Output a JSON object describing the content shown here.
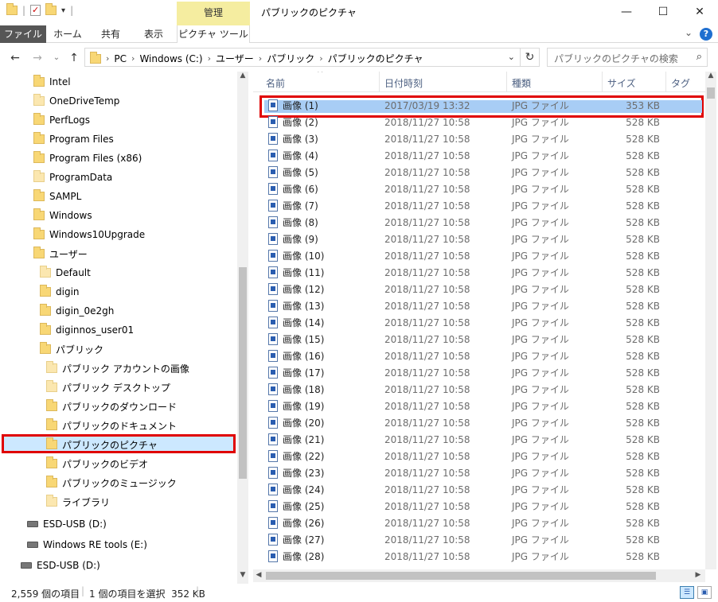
{
  "window": {
    "title": "パブリックのピクチャ",
    "context_tab": "管理"
  },
  "ribbon": {
    "tabs": [
      "ファイル",
      "ホーム",
      "共有",
      "表示",
      "ピクチャ ツール"
    ],
    "help": "?"
  },
  "address": {
    "segments": [
      "PC",
      "Windows (C:)",
      "ユーザー",
      "パブリック",
      "パブリックのピクチャ"
    ],
    "search_placeholder": "パブリックのピクチャの検索"
  },
  "nav_tree": [
    {
      "label": "Intel",
      "indent": 0,
      "light": false
    },
    {
      "label": "OneDriveTemp",
      "indent": 0,
      "light": true
    },
    {
      "label": "PerfLogs",
      "indent": 0,
      "light": false
    },
    {
      "label": "Program Files",
      "indent": 0,
      "light": false
    },
    {
      "label": "Program Files (x86)",
      "indent": 0,
      "light": false
    },
    {
      "label": "ProgramData",
      "indent": 0,
      "light": true
    },
    {
      "label": "SAMPL",
      "indent": 0,
      "light": false
    },
    {
      "label": "Windows",
      "indent": 0,
      "light": false
    },
    {
      "label": "Windows10Upgrade",
      "indent": 0,
      "light": false
    },
    {
      "label": "ユーザー",
      "indent": 0,
      "light": false
    },
    {
      "label": "Default",
      "indent": 1,
      "light": true
    },
    {
      "label": "digin",
      "indent": 1,
      "light": false
    },
    {
      "label": "digin_0e2gh",
      "indent": 1,
      "light": false
    },
    {
      "label": "diginnos_user01",
      "indent": 1,
      "light": false
    },
    {
      "label": "パブリック",
      "indent": 1,
      "light": false
    },
    {
      "label": "パブリック アカウントの画像",
      "indent": 2,
      "light": true
    },
    {
      "label": "パブリック デスクトップ",
      "indent": 2,
      "light": true
    },
    {
      "label": "パブリックのダウンロード",
      "indent": 2,
      "light": false
    },
    {
      "label": "パブリックのドキュメント",
      "indent": 2,
      "light": false
    },
    {
      "label": "パブリックのピクチャ",
      "indent": 2,
      "light": false
    },
    {
      "label": "パブリックのビデオ",
      "indent": 2,
      "light": false
    },
    {
      "label": "パブリックのミュージック",
      "indent": 2,
      "light": false
    },
    {
      "label": "ライブラリ",
      "indent": 2,
      "light": true
    }
  ],
  "drives": [
    {
      "label": "ESD-USB (D:)",
      "indent": 0
    },
    {
      "label": "Windows RE tools (E:)",
      "indent": 0
    },
    {
      "label": "ESD-USB (D:)",
      "indent": -1
    }
  ],
  "columns": [
    "名前",
    "日付時刻",
    "種類",
    "サイズ",
    "タグ"
  ],
  "files": [
    {
      "name": "画像 (1)",
      "date": "2017/03/19 13:32",
      "type": "JPG ファイル",
      "size": "353 KB"
    },
    {
      "name": "画像 (2)",
      "date": "2018/11/27 10:58",
      "type": "JPG ファイル",
      "size": "528 KB"
    },
    {
      "name": "画像 (3)",
      "date": "2018/11/27 10:58",
      "type": "JPG ファイル",
      "size": "528 KB"
    },
    {
      "name": "画像 (4)",
      "date": "2018/11/27 10:58",
      "type": "JPG ファイル",
      "size": "528 KB"
    },
    {
      "name": "画像 (5)",
      "date": "2018/11/27 10:58",
      "type": "JPG ファイル",
      "size": "528 KB"
    },
    {
      "name": "画像 (6)",
      "date": "2018/11/27 10:58",
      "type": "JPG ファイル",
      "size": "528 KB"
    },
    {
      "name": "画像 (7)",
      "date": "2018/11/27 10:58",
      "type": "JPG ファイル",
      "size": "528 KB"
    },
    {
      "name": "画像 (8)",
      "date": "2018/11/27 10:58",
      "type": "JPG ファイル",
      "size": "528 KB"
    },
    {
      "name": "画像 (9)",
      "date": "2018/11/27 10:58",
      "type": "JPG ファイル",
      "size": "528 KB"
    },
    {
      "name": "画像 (10)",
      "date": "2018/11/27 10:58",
      "type": "JPG ファイル",
      "size": "528 KB"
    },
    {
      "name": "画像 (11)",
      "date": "2018/11/27 10:58",
      "type": "JPG ファイル",
      "size": "528 KB"
    },
    {
      "name": "画像 (12)",
      "date": "2018/11/27 10:58",
      "type": "JPG ファイル",
      "size": "528 KB"
    },
    {
      "name": "画像 (13)",
      "date": "2018/11/27 10:58",
      "type": "JPG ファイル",
      "size": "528 KB"
    },
    {
      "name": "画像 (14)",
      "date": "2018/11/27 10:58",
      "type": "JPG ファイル",
      "size": "528 KB"
    },
    {
      "name": "画像 (15)",
      "date": "2018/11/27 10:58",
      "type": "JPG ファイル",
      "size": "528 KB"
    },
    {
      "name": "画像 (16)",
      "date": "2018/11/27 10:58",
      "type": "JPG ファイル",
      "size": "528 KB"
    },
    {
      "name": "画像 (17)",
      "date": "2018/11/27 10:58",
      "type": "JPG ファイル",
      "size": "528 KB"
    },
    {
      "name": "画像 (18)",
      "date": "2018/11/27 10:58",
      "type": "JPG ファイル",
      "size": "528 KB"
    },
    {
      "name": "画像 (19)",
      "date": "2018/11/27 10:58",
      "type": "JPG ファイル",
      "size": "528 KB"
    },
    {
      "name": "画像 (20)",
      "date": "2018/11/27 10:58",
      "type": "JPG ファイル",
      "size": "528 KB"
    },
    {
      "name": "画像 (21)",
      "date": "2018/11/27 10:58",
      "type": "JPG ファイル",
      "size": "528 KB"
    },
    {
      "name": "画像 (22)",
      "date": "2018/11/27 10:58",
      "type": "JPG ファイル",
      "size": "528 KB"
    },
    {
      "name": "画像 (23)",
      "date": "2018/11/27 10:58",
      "type": "JPG ファイル",
      "size": "528 KB"
    },
    {
      "name": "画像 (24)",
      "date": "2018/11/27 10:58",
      "type": "JPG ファイル",
      "size": "528 KB"
    },
    {
      "name": "画像 (25)",
      "date": "2018/11/27 10:58",
      "type": "JPG ファイル",
      "size": "528 KB"
    },
    {
      "name": "画像 (26)",
      "date": "2018/11/27 10:58",
      "type": "JPG ファイル",
      "size": "528 KB"
    },
    {
      "name": "画像 (27)",
      "date": "2018/11/27 10:58",
      "type": "JPG ファイル",
      "size": "528 KB"
    },
    {
      "name": "画像 (28)",
      "date": "2018/11/27 10:58",
      "type": "JPG ファイル",
      "size": "528 KB"
    }
  ],
  "status": {
    "count": "2,559 個の項目",
    "selection": "1 個の項目を選択  352 KB"
  },
  "colors": {
    "selection": "#cce8ff",
    "highlight_border": "#e00000",
    "selected_row": "#a8cdf5",
    "context_tab": "#f5eda0"
  }
}
